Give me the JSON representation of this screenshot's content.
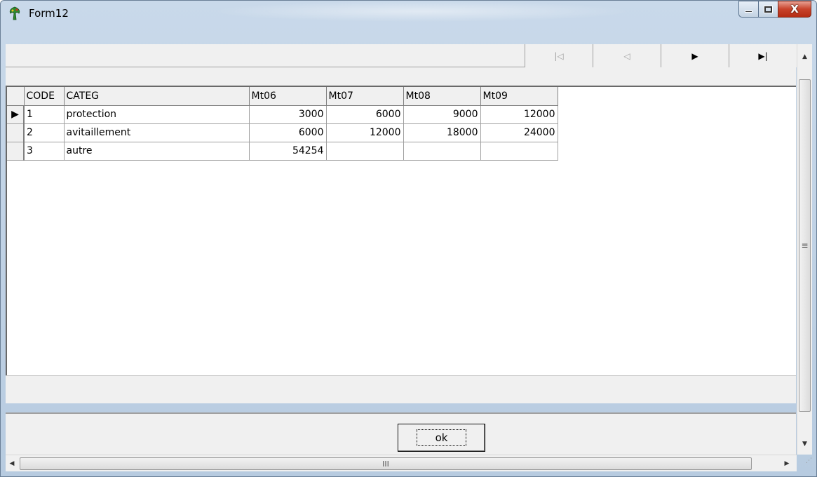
{
  "window": {
    "title": "Form12",
    "icon": "app-tree-icon",
    "caption_buttons": [
      "minimize-icon",
      "maximize-icon",
      "close-icon"
    ],
    "close_glyph": "X"
  },
  "navigator": {
    "buttons": [
      {
        "name": "first",
        "glyph": "|◁",
        "enabled": false
      },
      {
        "name": "prior",
        "glyph": "◁",
        "enabled": false
      },
      {
        "name": "next",
        "glyph": "▶",
        "enabled": true
      },
      {
        "name": "last",
        "glyph": "▶|",
        "enabled": true
      }
    ]
  },
  "grid": {
    "columns": [
      "CODE",
      "CATEG",
      "Mt06",
      "Mt07",
      "Mt08",
      "Mt09"
    ],
    "rows": [
      {
        "code": "1",
        "categ": "protection",
        "mt06": "3000",
        "mt07": "6000",
        "mt08": "9000",
        "mt09": "12000",
        "current": true
      },
      {
        "code": "2",
        "categ": "avitaillement",
        "mt06": "6000",
        "mt07": "12000",
        "mt08": "18000",
        "mt09": "24000",
        "current": false
      },
      {
        "code": "3",
        "categ": "autre",
        "mt06": "54254",
        "mt07": "",
        "mt08": "",
        "mt09": "",
        "current": false
      }
    ],
    "current_row_indicator": "▶"
  },
  "ok_button": {
    "label": "ok"
  },
  "scrollbars": {
    "v_up": "▲",
    "v_down": "▼",
    "v_grip": "≡",
    "h_left": "◀",
    "h_right": "▶",
    "h_grip": "III"
  }
}
